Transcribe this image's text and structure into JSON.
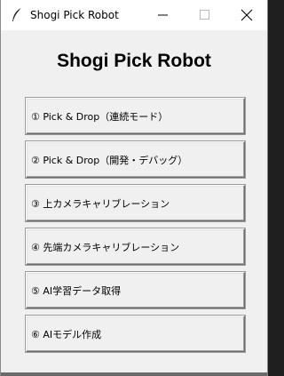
{
  "window": {
    "title": "Shogi Pick Robot"
  },
  "heading": "Shogi Pick Robot",
  "buttons": [
    {
      "label": "① Pick & Drop（連続モード）"
    },
    {
      "label": "② Pick & Drop（開発・デバッグ）"
    },
    {
      "label": "③ 上カメラキャリブレーション"
    },
    {
      "label": "④ 先端カメラキャリブレーション"
    },
    {
      "label": "⑤ AI学習データ取得"
    },
    {
      "label": "⑥ AIモデル作成"
    }
  ],
  "icons": {
    "app": "feather-icon",
    "minimize": "minimize-icon",
    "maximize": "maximize-icon",
    "close": "close-icon"
  }
}
